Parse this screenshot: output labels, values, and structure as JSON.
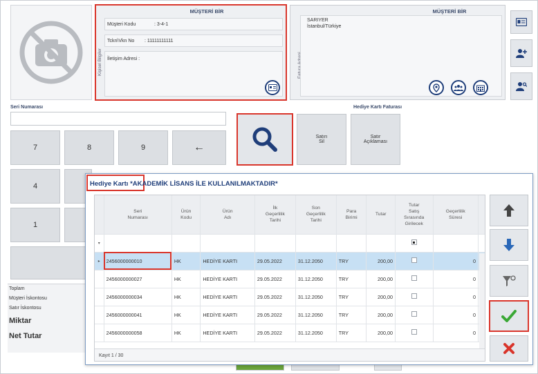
{
  "customer": {
    "panel_title": "MÜŞTERİ BİR",
    "side_label": "Kişisel Bilgiler",
    "code_label": "Müşteri Kodu",
    "code_value": ": 3-4-1",
    "tax_label": "Tckn\\Vkn No",
    "tax_value": ": 11111111111",
    "contact_label": "İletişim Adresi :"
  },
  "invoice": {
    "panel_title": "MÜŞTERİ BİR",
    "side_label": "Fatura Adresi",
    "line1": "SARIYER",
    "line2": "İstanbul/Türkiye"
  },
  "serial": {
    "label": "Seri Numarası"
  },
  "keypad": {
    "k7": "7",
    "k8": "8",
    "k9": "9",
    "back": "←",
    "k4": "4",
    "k1": "1"
  },
  "actions": {
    "section_title": "Hediye Kartı Faturası",
    "cancel_sale": "Satırı\nSil",
    "sale_note": "Satır\nAçıklaması"
  },
  "totals": {
    "total": "Toplam",
    "customer_discount": "Müşteri İskontosu",
    "line_discount": "Satır İskontosu",
    "quantity": "Miktar",
    "net_total": "Net Tutar"
  },
  "dialog": {
    "title_prefix": "Hediye Kartı",
    "title_note": " *AKADEMİK LİSANS İLE KULLANILMAKTADIR*",
    "footer": "Kayıt 1 / 30",
    "columns": [
      "Seri\nNumarası",
      "Ürün\nKodu",
      "Ürün\nAdı",
      "İlk\nGeçerlilik\nTarihi",
      "Son\nGeçerlilik\nTarihi",
      "Para\nBirimi",
      "Tutar",
      "Tutar\nSatış\nSırasında\nGirilecek",
      "Geçerlilik\nSüresi"
    ],
    "rows": [
      {
        "serial": "2456000000010",
        "code": "HK",
        "name": "HEDİYE KARTI",
        "start": "29.05.2022",
        "end": "31.12.2050",
        "currency": "TRY",
        "amount": "200,00",
        "validity": "0"
      },
      {
        "serial": "2456000000027",
        "code": "HK",
        "name": "HEDİYE KARTI",
        "start": "29.05.2022",
        "end": "31.12.2050",
        "currency": "TRY",
        "amount": "200,00",
        "validity": "0"
      },
      {
        "serial": "2456000000034",
        "code": "HK",
        "name": "HEDİYE KARTI",
        "start": "29.05.2022",
        "end": "31.12.2050",
        "currency": "TRY",
        "amount": "200,00",
        "validity": "0"
      },
      {
        "serial": "2456000000041",
        "code": "HK",
        "name": "HEDİYE KARTI",
        "start": "29.05.2022",
        "end": "31.12.2050",
        "currency": "TRY",
        "amount": "200,00",
        "validity": "0"
      },
      {
        "serial": "2456000000058",
        "code": "HK",
        "name": "HEDİYE KARTI",
        "start": "29.05.2022",
        "end": "31.12.2050",
        "currency": "TRY",
        "amount": "200,00",
        "validity": "0"
      }
    ]
  },
  "colors": {
    "accent_blue": "#1f3e7a",
    "highlight_red": "#d9352b",
    "selected_row": "#c7e0f4",
    "confirm_green": "#3aa835"
  },
  "icons": [
    "no-photo-icon",
    "id-card-icon",
    "location-icon",
    "users-icon",
    "building-icon",
    "search-icon",
    "arrow-up-icon",
    "arrow-down-icon",
    "filter-icon",
    "check-icon",
    "close-icon"
  ]
}
